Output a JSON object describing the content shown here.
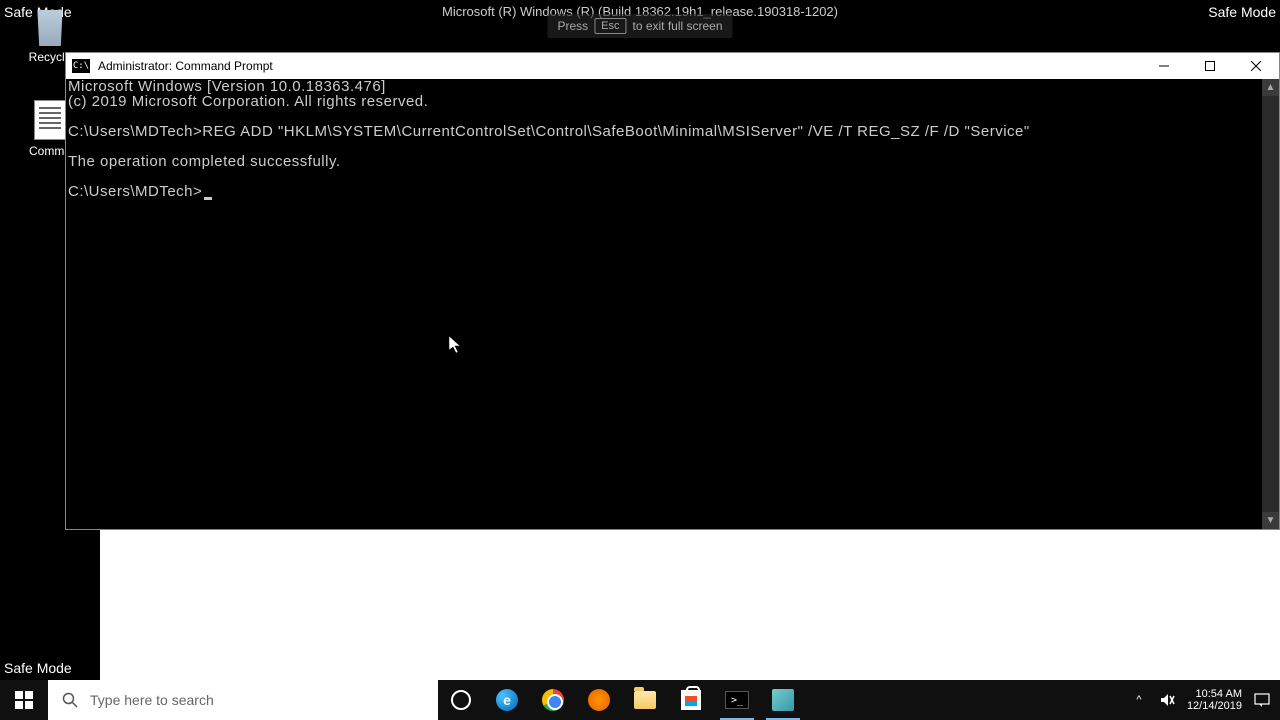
{
  "safe_mode_label": "Safe Mode",
  "build_info": "Microsoft (R) Windows (R) (Build 18362.19h1_release.190318-1202)",
  "fullscreen_hint": {
    "press": "Press",
    "key": "Esc",
    "rest": "to exit full screen"
  },
  "desktop": {
    "recycle_bin": "Recycle",
    "cmd_shortcut": "Comma"
  },
  "cmd_window": {
    "title": "Administrator: Command Prompt",
    "icon_text": "C:\\",
    "lines": {
      "ver": "Microsoft Windows [Version 10.0.18363.476]",
      "copyright": "(c) 2019 Microsoft Corporation. All rights reserved.",
      "blank1": "",
      "prompt1": "C:\\Users\\MDTech>REG ADD \"HKLM\\SYSTEM\\CurrentControlSet\\Control\\SafeBoot\\Minimal\\MSIServer\" /VE /T REG_SZ /F /D \"Service\"",
      "blank2": "",
      "result": "The operation completed successfully.",
      "blank3": "",
      "prompt2": "C:\\Users\\MDTech>"
    }
  },
  "taskbar": {
    "search_placeholder": "Type here to search",
    "tray": {
      "time": "10:54 AM",
      "date": "12/14/2019",
      "chevron": "^"
    }
  }
}
